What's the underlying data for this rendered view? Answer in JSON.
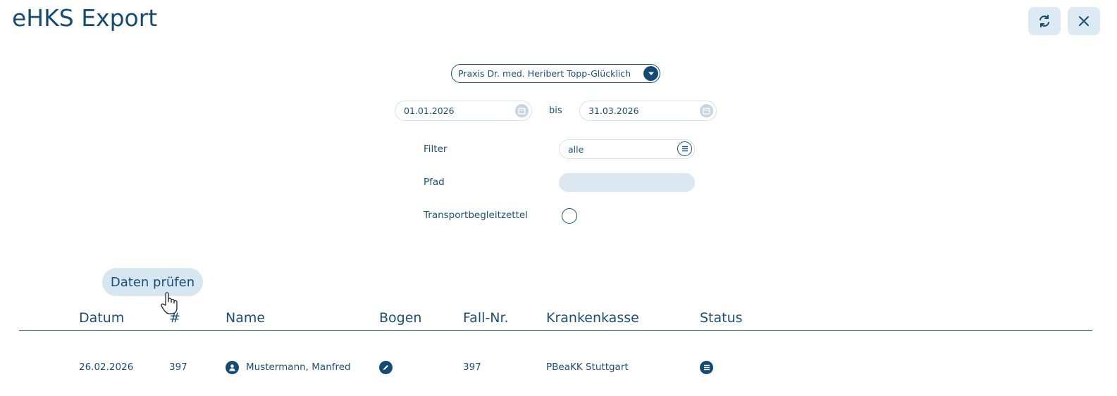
{
  "window": {
    "title": "eHKS Export",
    "refresh_icon": "refresh-icon",
    "close_icon": "close-icon"
  },
  "form": {
    "practice": "Praxis Dr. med. Heribert Topp-Glücklich",
    "date_from": "01.01.2026",
    "date_separator": "bis",
    "date_to": "31.03.2026",
    "filter_label": "Filter",
    "filter_value": "alle",
    "path_label": "Pfad",
    "path_value": "",
    "transport_label": "Transportbegleitzettel",
    "transport_checked": false
  },
  "actions": {
    "check_data_label": "Daten prüfen"
  },
  "table": {
    "columns": [
      "Datum",
      "#",
      "Name",
      "Bogen",
      "Fall-Nr.",
      "Krankenkasse",
      "Status"
    ],
    "rows": [
      {
        "datum": "26.02.2026",
        "nr": "397",
        "name": "Mustermann, Manfred",
        "fall_nr": "397",
        "krankenkasse": "PBeaKK Stuttgart"
      }
    ]
  },
  "colors": {
    "primary": "#154a74",
    "light_accent": "#d6e7f2",
    "border_light": "#d6e3ec"
  }
}
